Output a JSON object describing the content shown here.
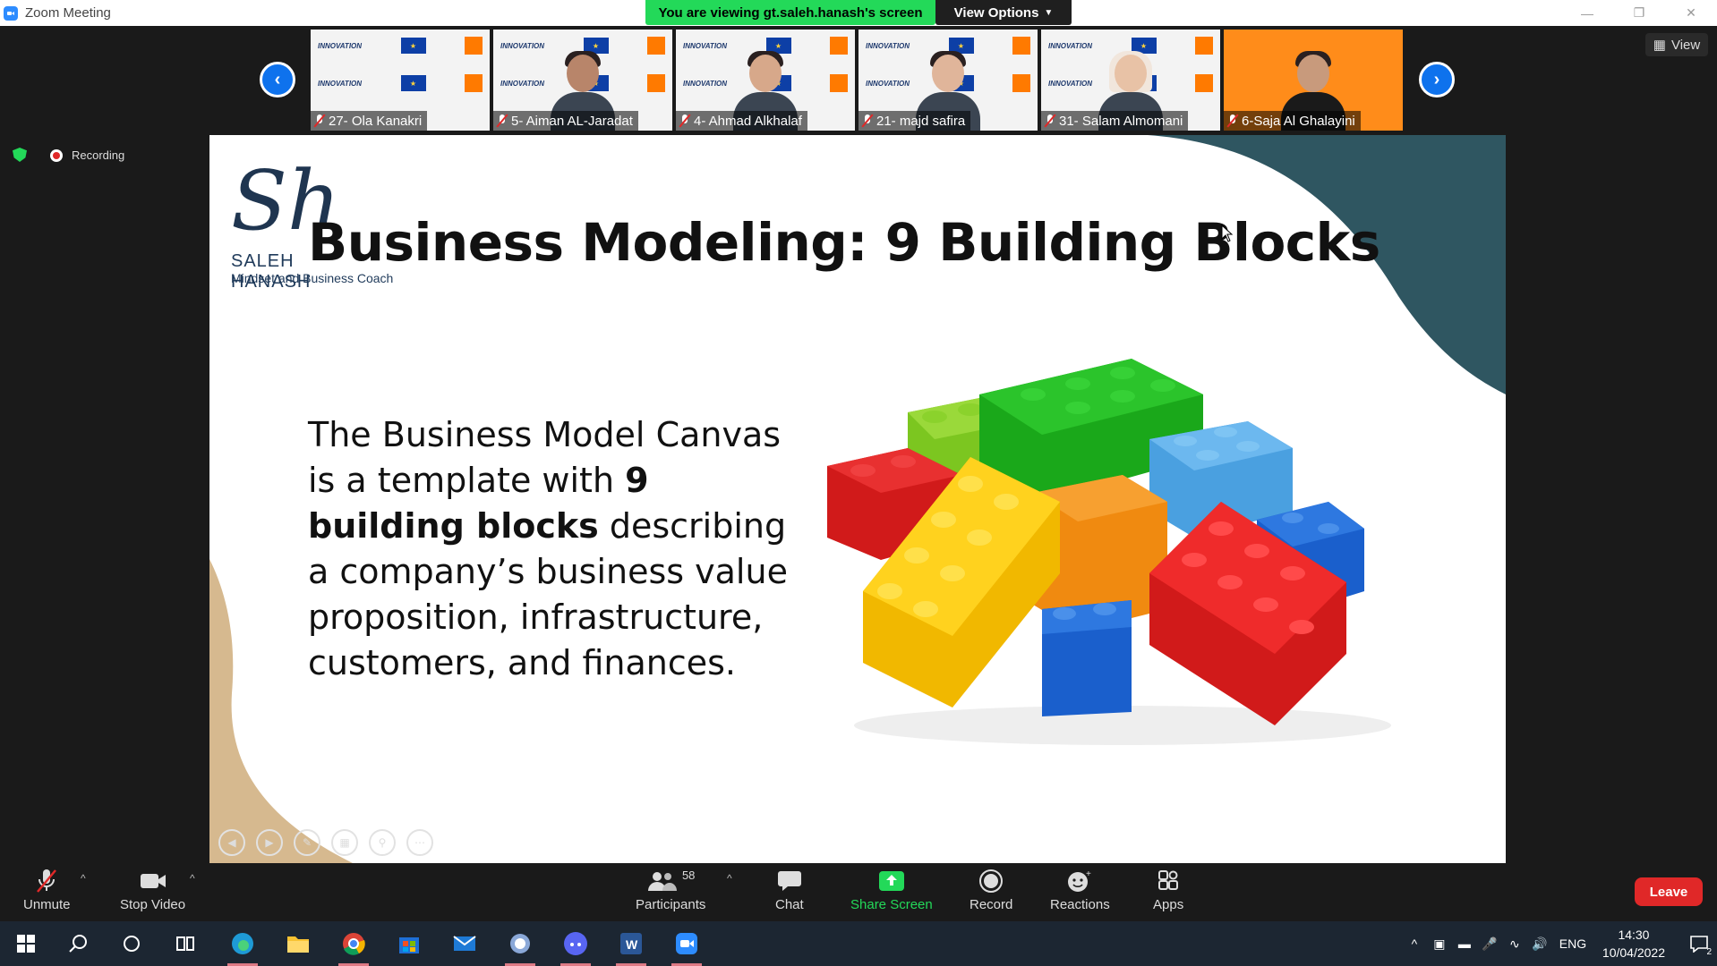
{
  "window": {
    "title": "Zoom Meeting"
  },
  "banner": {
    "viewing_text": "You are viewing gt.saleh.hanash's screen",
    "view_options_label": "View Options"
  },
  "view_button_label": "View",
  "recording_label": "Recording",
  "participants_strip": [
    {
      "name": "27- Ola Kanakri",
      "has_person": false
    },
    {
      "name": "5- Aiman AL-Jaradat",
      "has_person": true
    },
    {
      "name": "4- Ahmad Alkhalaf",
      "has_person": true
    },
    {
      "name": "21- majd safira",
      "has_person": true
    },
    {
      "name": "31- Salam Almomani",
      "has_person": true
    },
    {
      "name": "6-Saja Al Ghalayini",
      "has_person": true
    }
  ],
  "thumbnail_banner": {
    "innovation": "INNOVATION",
    "eu_text": "★"
  },
  "slide": {
    "logo_script": "Sh",
    "logo_name": "SALEH HANASH",
    "logo_tagline": "Mindset and Business Coach",
    "title": "Business Modeling: 9 Building Blocks",
    "body_part1": "The Business Model Canvas is a template with ",
    "body_bold": "9 building blocks",
    "body_part2": " describing a company’s business value proposition, infrastructure, customers, and finances."
  },
  "toolbar": {
    "unmute": "Unmute",
    "stop_video": "Stop Video",
    "participants": "Participants",
    "participants_count": "58",
    "chat": "Chat",
    "share_screen": "Share Screen",
    "record": "Record",
    "reactions": "Reactions",
    "apps": "Apps",
    "leave": "Leave"
  },
  "taskbar": {
    "language": "ENG",
    "time": "14:30",
    "date": "10/04/2022",
    "notifications": "2"
  },
  "colors": {
    "zoom_blue": "#0e72ed",
    "share_green": "#23d959",
    "leave_red": "#e02828",
    "slide_teal": "#2f5661",
    "slide_tan": "#d6b98f"
  }
}
